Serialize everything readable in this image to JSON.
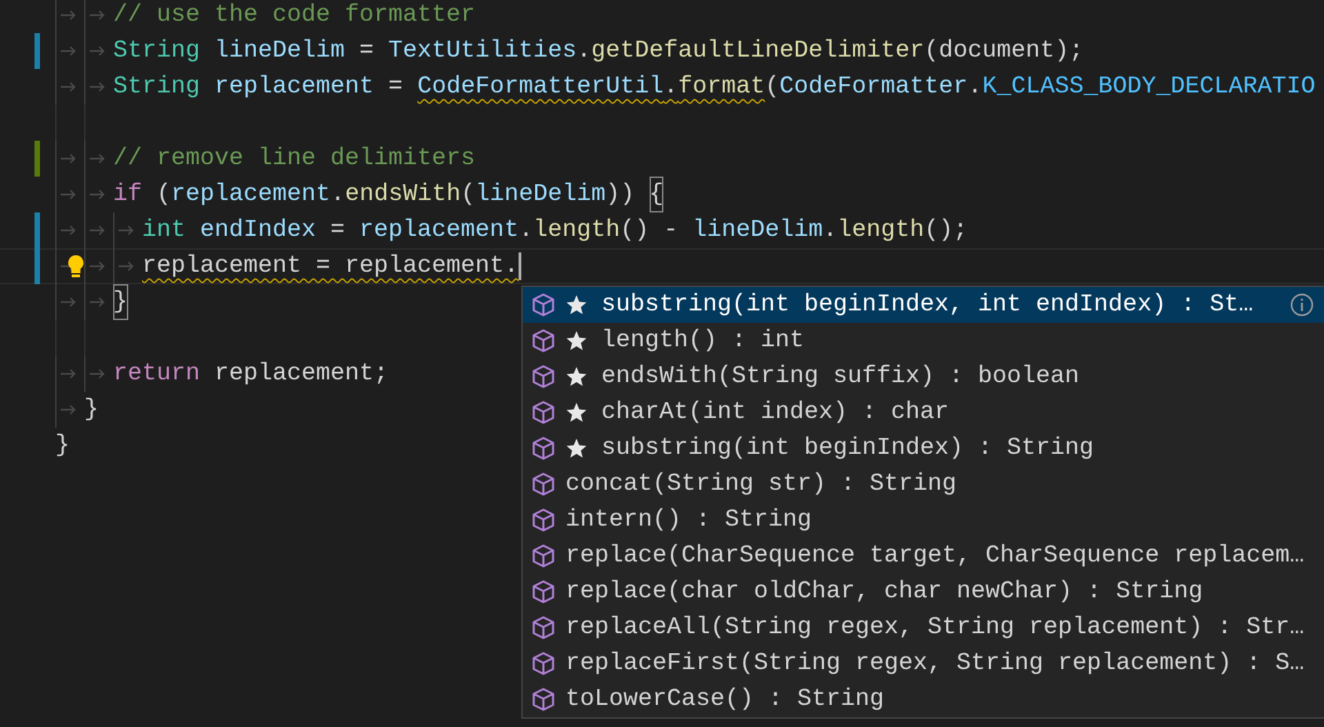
{
  "editor": {
    "lines": [
      {
        "kind": "block",
        "children": [
          {
            "kind": "block",
            "children": [
              {
                "kind": "code",
                "tokens": [
                  {
                    "text": "// use the code formatter",
                    "kind": "comment"
                  }
                ]
              },
              {
                "kind": "code",
                "color": "#1b81a8",
                "tokens": [
                  {
                    "text": "String ",
                    "kind": "type"
                  },
                  {
                    "text": "lineDelim",
                    "kind": "variable"
                  },
                  {
                    "text": " = ",
                    "kind": "plain"
                  },
                  {
                    "text": "TextUtilities",
                    "kind": "variable"
                  },
                  {
                    "text": ".",
                    "kind": "plain"
                  },
                  {
                    "text": "getDefaultLineDelimiter",
                    "kind": "function"
                  },
                  {
                    "text": "(document);",
                    "kind": "plain"
                  }
                ]
              },
              {
                "kind": "code",
                "tokens": [
                  {
                    "text": "String ",
                    "kind": "type"
                  },
                  {
                    "text": "replacement",
                    "kind": "variable"
                  },
                  {
                    "text": " = ",
                    "kind": "plain"
                  },
                  {
                    "text": "CodeFormatterUtil",
                    "kind": "variable",
                    "warning": true
                  },
                  {
                    "text": ".",
                    "kind": "plain",
                    "warning": true
                  },
                  {
                    "text": "format",
                    "kind": "function",
                    "warning": true
                  },
                  {
                    "text": "(",
                    "kind": "plain"
                  },
                  {
                    "text": "CodeFormatter",
                    "kind": "variable"
                  },
                  {
                    "text": ".",
                    "kind": "plain"
                  },
                  {
                    "text": "K_CLASS_BODY_DECLARATIO",
                    "kind": "constant"
                  }
                ]
              },
              {
                "kind": "blank"
              },
              {
                "kind": "code",
                "color": "#587c0c",
                "tokens": [
                  {
                    "text": "// remove line delimiters",
                    "kind": "comment"
                  }
                ]
              },
              {
                "kind": "code",
                "tokens": [
                  {
                    "text": "if",
                    "kind": "keyword"
                  },
                  {
                    "text": " (",
                    "kind": "plain"
                  },
                  {
                    "text": "replacement",
                    "kind": "variable"
                  },
                  {
                    "text": ".",
                    "kind": "plain"
                  },
                  {
                    "text": "endsWith",
                    "kind": "function"
                  },
                  {
                    "text": "(",
                    "kind": "plain"
                  },
                  {
                    "text": "lineDelim",
                    "kind": "variable"
                  },
                  {
                    "text": ")) ",
                    "kind": "plain"
                  },
                  {
                    "text": "{",
                    "kind": "plain",
                    "bracket_match": true
                  }
                ],
                "children": [
                  {
                    "kind": "code",
                    "color": "#1b81a8",
                    "tokens": [
                      {
                        "text": "int ",
                        "kind": "type"
                      },
                      {
                        "text": "endIndex",
                        "kind": "variable"
                      },
                      {
                        "text": " = ",
                        "kind": "plain"
                      },
                      {
                        "text": "replacement",
                        "kind": "variable"
                      },
                      {
                        "text": ".",
                        "kind": "plain"
                      },
                      {
                        "text": "length",
                        "kind": "function"
                      },
                      {
                        "text": "() - ",
                        "kind": "plain"
                      },
                      {
                        "text": "lineDelim",
                        "kind": "variable"
                      },
                      {
                        "text": ".",
                        "kind": "plain"
                      },
                      {
                        "text": "length",
                        "kind": "function"
                      },
                      {
                        "text": "();",
                        "kind": "plain"
                      }
                    ]
                  },
                  {
                    "kind": "code",
                    "color": "#1b81a8",
                    "lightbulb": true,
                    "current": true,
                    "tokens": [
                      {
                        "text": "replacement = replacement.",
                        "kind": "plain",
                        "warning": true
                      }
                    ]
                  }
                ]
              },
              {
                "kind": "code",
                "tokens": [
                  {
                    "text": "}",
                    "kind": "plain",
                    "bracket_match": true
                  }
                ]
              },
              {
                "kind": "blank"
              },
              {
                "kind": "code",
                "tokens": [
                  {
                    "text": "return",
                    "kind": "keyword"
                  },
                  {
                    "text": " replacement;",
                    "kind": "plain"
                  }
                ]
              }
            ]
          },
          {
            "kind": "code",
            "tokens": [
              {
                "text": "}",
                "kind": "plain"
              }
            ]
          }
        ]
      },
      {
        "kind": "code",
        "tokens": [
          {
            "text": "}",
            "kind": "plain"
          }
        ]
      },
      {
        "kind": "blank"
      }
    ]
  },
  "suggestions": [
    {
      "label": "substring(int beginIndex, int endIndex) : St…",
      "starred": true,
      "selected": true
    },
    {
      "label": "length() : int",
      "starred": true,
      "selected": false
    },
    {
      "label": "endsWith(String suffix) : boolean",
      "starred": true,
      "selected": false
    },
    {
      "label": "charAt(int index) : char",
      "starred": true,
      "selected": false
    },
    {
      "label": "substring(int beginIndex) : String",
      "starred": true,
      "selected": false
    },
    {
      "label": "concat(String str) : String",
      "starred": false,
      "selected": false
    },
    {
      "label": "intern() : String",
      "starred": false,
      "selected": false
    },
    {
      "label": "replace(CharSequence target, CharSequence replacem…",
      "starred": false,
      "selected": false
    },
    {
      "label": "replace(char oldChar, char newChar) : String",
      "starred": false,
      "selected": false
    },
    {
      "label": "replaceAll(String regex, String replacement) : Str…",
      "starred": false,
      "selected": false
    },
    {
      "label": "replaceFirst(String regex, String replacement) : S…",
      "starred": false,
      "selected": false
    },
    {
      "label": "toLowerCase() : String",
      "starred": false,
      "selected": false
    }
  ]
}
